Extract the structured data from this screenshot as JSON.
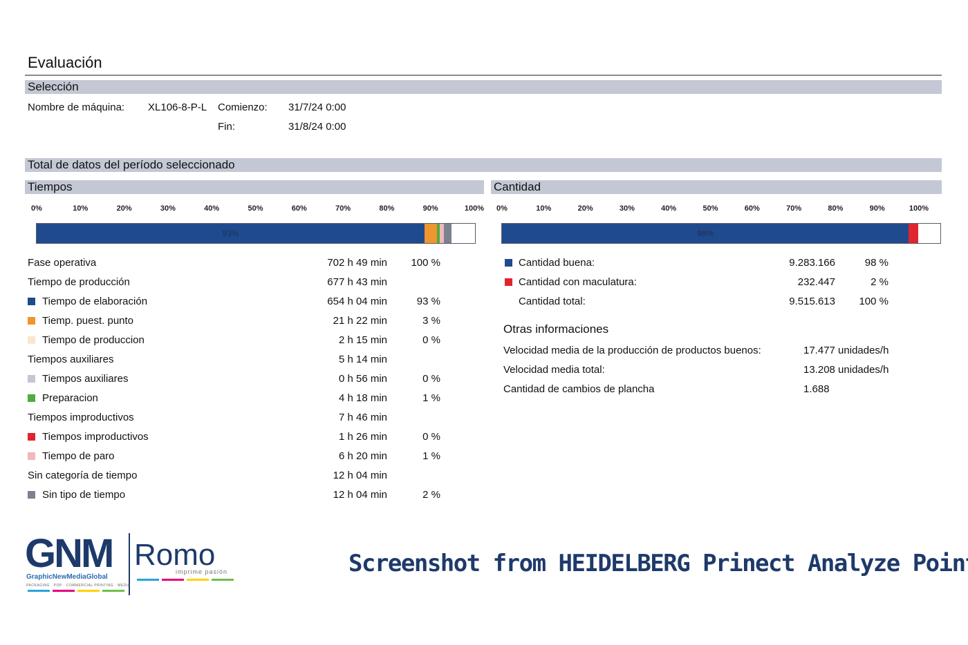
{
  "page_title": "Evaluación",
  "selection": {
    "header": "Selección",
    "machine_label": "Nombre de máquina:",
    "machine_value": "XL106-8-P-L",
    "start_label": "Comienzo:",
    "start_value": "31/7/24 0:00",
    "end_label": "Fin:",
    "end_value": "31/8/24 0:00"
  },
  "totals_header": "Total de datos del período seleccionado",
  "scale_ticks": [
    "0%",
    "10%",
    "20%",
    "30%",
    "40%",
    "50%",
    "60%",
    "70%",
    "80%",
    "90%",
    "100%"
  ],
  "tiempos": {
    "header": "Tiempos",
    "bar": {
      "label": "93%",
      "segments": [
        {
          "name": "Tiempo de elaboración",
          "fraction": 0.885,
          "color": "#1f4b8e"
        },
        {
          "name": "Tiemp. puest. punto",
          "fraction": 0.029,
          "color": "#f0962e"
        },
        {
          "name": "Preparacion",
          "fraction": 0.006,
          "color": "#4cae3c"
        },
        {
          "name": "Tiempo de paro",
          "fraction": 0.009,
          "color": "#f1b7bd"
        },
        {
          "name": "Sin tipo de tiempo",
          "fraction": 0.017,
          "color": "#7c8190"
        }
      ]
    },
    "rows": [
      {
        "label": "Fase operativa",
        "value": "702 h 49 min",
        "percent": "100 %",
        "color": ""
      },
      {
        "label": "Tiempo de producción",
        "value": "677 h 43 min",
        "percent": "",
        "color": ""
      },
      {
        "label": "Tiempo de elaboración",
        "value": "654 h 04 min",
        "percent": "93 %",
        "color": "#1f4b8e"
      },
      {
        "label": "Tiemp. puest. punto",
        "value": "21 h 22 min",
        "percent": "3 %",
        "color": "#f0962e"
      },
      {
        "label": "Tiempo de produccion",
        "value": "2 h 15 min",
        "percent": "0 %",
        "color": "#fbe6cc"
      },
      {
        "label": "Tiempos auxiliares",
        "value": "5 h 14 min",
        "percent": "",
        "color": ""
      },
      {
        "label": "Tiempos auxiliares",
        "value": "0 h 56 min",
        "percent": "0 %",
        "color": "#c3c7d3"
      },
      {
        "label": "Preparacion",
        "value": "4 h 18 min",
        "percent": "1 %",
        "color": "#4cae3c"
      },
      {
        "label": "Tiempos improductivos",
        "value": "7 h 46 min",
        "percent": "",
        "color": ""
      },
      {
        "label": "Tiempos improductivos",
        "value": "1 h 26 min",
        "percent": "0 %",
        "color": "#e0252e"
      },
      {
        "label": "Tiempo de paro",
        "value": "6 h 20 min",
        "percent": "1 %",
        "color": "#f1b7bd"
      },
      {
        "label": "Sin categoría de tiempo",
        "value": "12 h 04 min",
        "percent": "",
        "color": ""
      },
      {
        "label": "Sin tipo de tiempo",
        "value": "12 h 04 min",
        "percent": "2 %",
        "color": "#7c8190"
      }
    ]
  },
  "cantidad": {
    "header": "Cantidad",
    "bar": {
      "label": "98%",
      "segments": [
        {
          "name": "Cantidad buena",
          "fraction": 0.928,
          "color": "#1f4b8e"
        },
        {
          "name": "Cantidad con maculatura",
          "fraction": 0.022,
          "color": "#e0252e"
        }
      ]
    },
    "rows": [
      {
        "label": "Cantidad buena:",
        "value": "9.283.166",
        "percent": "98 %",
        "color": "#1f4b8e"
      },
      {
        "label": "Cantidad con maculatura:",
        "value": "232.447",
        "percent": "2 %",
        "color": "#e0252e"
      },
      {
        "label": "Cantidad total:",
        "value": "9.515.613",
        "percent": "100 %",
        "color": ""
      }
    ]
  },
  "otras": {
    "header": "Otras informaciones",
    "rows": [
      {
        "label": "Velocidad media de la producción de productos buenos:",
        "value": "17.477 unidades/h"
      },
      {
        "label": "Velocidad media total:",
        "value": "13.208 unidades/h"
      },
      {
        "label": "Cantidad de cambios de plancha",
        "value": "1.688"
      }
    ]
  },
  "branding": {
    "logo_gnm": "GNM",
    "logo_romo": "Romo",
    "logo_sub": "GraphicNewMediaGlobal",
    "logo_tag": "imprime pasión",
    "logo_tiny": "PACKAGING · POP · COMMERCIAL PRINTING · MEDIA",
    "caption": "Screenshot from HEIDELBERG Prinect Analyze Point",
    "accent_colors": [
      "#29a3dc",
      "#e6007e",
      "#ffd200",
      "#6cbf4b"
    ]
  }
}
